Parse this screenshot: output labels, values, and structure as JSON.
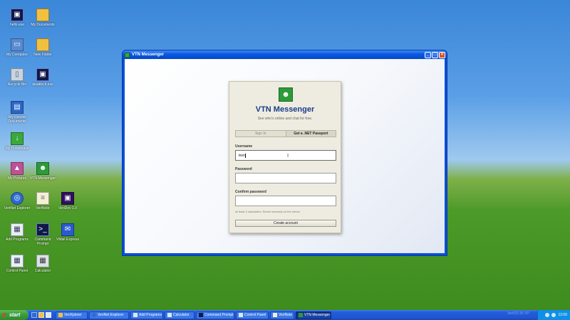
{
  "desktop": {
    "icons": [
      {
        "label": "hello.exe",
        "glyph": "▣"
      },
      {
        "label": "My Documents",
        "glyph": ""
      },
      {
        "label": "My Computer",
        "glyph": "▭"
      },
      {
        "label": "New Folder",
        "glyph": ""
      },
      {
        "label": "Recycle Bin",
        "glyph": "▯"
      },
      {
        "label": "deadlock.exe",
        "glyph": "▣"
      },
      {
        "label": "My Recent Documents",
        "glyph": "▤"
      },
      {
        "label": "My Downloads",
        "glyph": "↓"
      },
      {
        "label": "My Pictures",
        "glyph": "▲"
      },
      {
        "label": "VTN Messenger",
        "glyph": "☻"
      },
      {
        "label": "VeriNet Explorer",
        "glyph": "◎"
      },
      {
        "label": "VeriNote",
        "glyph": "≡"
      },
      {
        "label": "VeriDev 1.0",
        "glyph": "▣"
      },
      {
        "label": "Add Programs",
        "glyph": "▦"
      },
      {
        "label": "Command Prompt",
        "glyph": ">_"
      },
      {
        "label": "VMail Express",
        "glyph": "✉"
      },
      {
        "label": "Control Panel",
        "glyph": "▦"
      },
      {
        "label": "Calculator",
        "glyph": "▦"
      }
    ]
  },
  "window": {
    "title": "VTN Messenger",
    "buttons": {
      "minimize": "_",
      "maximize": "□",
      "close": "×"
    }
  },
  "card": {
    "logo_glyph": "☻",
    "app_title": "VTN Messenger",
    "tagline": "See who's online and chat for free.",
    "tabs": {
      "sign_in": "Sign In",
      "get_passport": "Get a .NET Passport"
    },
    "username_label": "Username",
    "username_value": "test",
    "password_label": "Password",
    "password_value": "",
    "confirm_label": "Confirm password",
    "confirm_value": "",
    "hint": "At least 4 characters. Stored securely on the server.",
    "create_button": "Create account"
  },
  "taskbar": {
    "start_label": "start",
    "items": [
      {
        "label": "VeriXplorer"
      },
      {
        "label": "VeriNet Explorer"
      },
      {
        "label": "Add Programs"
      },
      {
        "label": "Calculator"
      },
      {
        "label": "Command Prompt"
      },
      {
        "label": "Control Panel"
      },
      {
        "label": "VeriNote"
      },
      {
        "label": "VTN Messenger"
      }
    ],
    "clock": "12:00",
    "watermark": "VeriOS 95 XP"
  },
  "colors": {
    "accent": "#2e9a3a",
    "title_blue": "#1a3c8c",
    "taskbar": "#245edb"
  }
}
